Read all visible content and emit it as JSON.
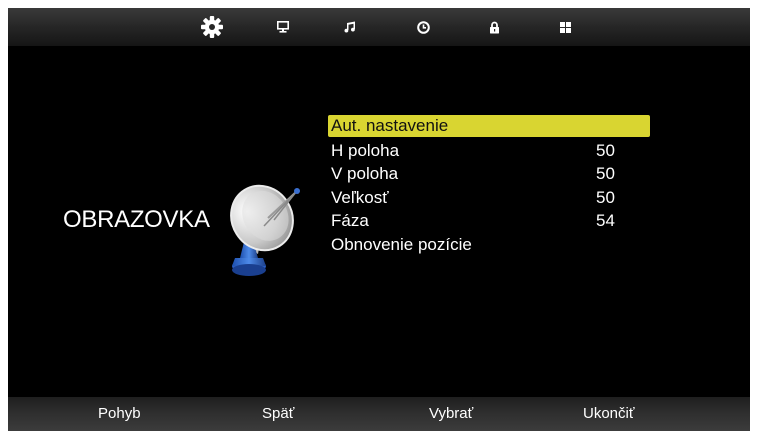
{
  "top_nav": {
    "icons": [
      "settings-gear-icon",
      "monitor-icon",
      "music-note-icon",
      "clock-icon",
      "lock-icon",
      "apps-grid-icon"
    ],
    "active_index": 0
  },
  "section": {
    "title": "OBRAZOVKA",
    "illustration": "satellite-dish"
  },
  "menu": {
    "selected_index": 0,
    "items": [
      {
        "label": "Aut. nastavenie",
        "value": ""
      },
      {
        "label": "H poloha",
        "value": "50"
      },
      {
        "label": "V poloha",
        "value": "50"
      },
      {
        "label": "Veľkosť",
        "value": "50"
      },
      {
        "label": "Fáza",
        "value": "54"
      },
      {
        "label": "Obnovenie pozície",
        "value": ""
      }
    ]
  },
  "bottom_hints": {
    "move": "Pohyb",
    "back": "Späť",
    "select": "Vybrať",
    "exit": "Ukončiť"
  },
  "colors": {
    "highlight": "#d9d531",
    "background": "#000000",
    "text": "#ffffff"
  }
}
